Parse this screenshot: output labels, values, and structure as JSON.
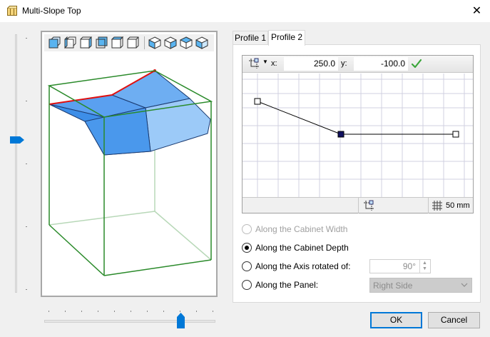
{
  "window": {
    "title": "Multi-Slope Top",
    "app_icon": "cabinet-icon",
    "close_glyph": "✕"
  },
  "vertical_slider": {
    "level_fraction": 0.42
  },
  "horizontal_slider": {
    "level_fraction": 0.8
  },
  "view_toolbar": {
    "buttons": [
      "view-front-icon",
      "view-left-icon",
      "view-right-icon",
      "view-back-icon",
      "view-top-icon",
      "view-bottom-icon",
      "view-iso-1-icon",
      "view-iso-2-icon",
      "view-iso-3-icon",
      "view-iso-4-icon"
    ]
  },
  "tabs": [
    {
      "label": "Profile 1",
      "active": false
    },
    {
      "label": "Profile 2",
      "active": true
    }
  ],
  "editor": {
    "x_label": "x:",
    "x_value": "250.0",
    "y_label": "y:",
    "y_value": "-100.0",
    "grid_size": "50 mm"
  },
  "options": [
    {
      "label": "Along the Cabinet Width",
      "checked": false,
      "disabled": true
    },
    {
      "label": "Along the Cabinet Depth",
      "checked": true,
      "disabled": false
    },
    {
      "label": "Along the Axis rotated of:",
      "checked": false,
      "disabled": false
    },
    {
      "label": "Along the Panel:",
      "checked": false,
      "disabled": false
    }
  ],
  "angle_value": "90°",
  "panel_value": "Right Side",
  "buttons": {
    "ok": "OK",
    "cancel": "Cancel"
  },
  "colors": {
    "accent": "#0078d7",
    "cabinet_edge": "#2a8a2a",
    "slope_fill": "#5aa0f0",
    "highlight_edge": "#e01010"
  }
}
